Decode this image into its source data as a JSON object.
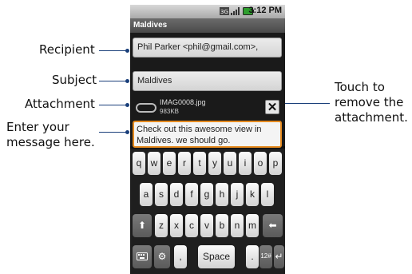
{
  "callouts": {
    "recipient": "Recipient",
    "subject": "Subject",
    "attachment": "Attachment",
    "enter_message_1": "Enter your",
    "enter_message_2": "message here.",
    "remove_1": "Touch to",
    "remove_2": "remove the",
    "remove_3": "attachment."
  },
  "status_bar": {
    "time": "3:12 PM"
  },
  "window": {
    "title": "Maldives"
  },
  "compose": {
    "recipient": "Phil Parker <phil@gmail.com>,",
    "subject": "Maldives",
    "attachment_name": "IMAG0008.jpg",
    "attachment_size": "983KB",
    "remove_symbol": "✕",
    "message_line1": "Check out this awesome view in",
    "message_line2": "Maldives. we should go."
  },
  "keyboard": {
    "row1": [
      "q",
      "w",
      "e",
      "r",
      "t",
      "y",
      "u",
      "i",
      "o",
      "p"
    ],
    "row2": [
      "a",
      "s",
      "d",
      "f",
      "g",
      "h",
      "j",
      "k",
      "l"
    ],
    "row3": [
      "z",
      "x",
      "c",
      "v",
      "b",
      "n",
      "m"
    ],
    "shift": "⬆",
    "delete": "⬅",
    "settings": "⚙",
    "comma": ",",
    "space": "Space",
    "period": ".",
    "symbols": "12#",
    "enter": "↵"
  },
  "colors": {
    "callout_line": "#1a3f7a",
    "message_border": "#e58a1f"
  }
}
